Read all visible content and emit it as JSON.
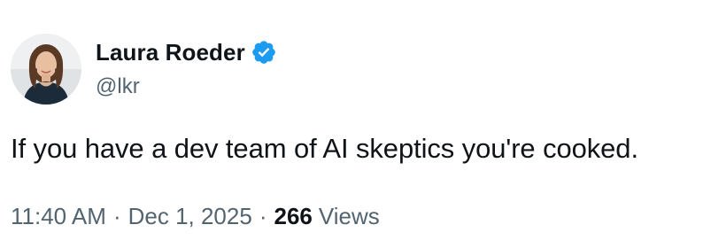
{
  "author": {
    "display_name": "Laura Roeder",
    "handle": "@lkr",
    "verified": true,
    "avatar_icon": "avatar-photo-icon",
    "verified_icon": "verified-badge-icon",
    "verified_color": "#1d9bf0"
  },
  "tweet": {
    "text": "If you have a dev team of AI skeptics you're cooked."
  },
  "meta": {
    "time": "11:40 AM",
    "separator": "·",
    "date": "Dec 1, 2025",
    "views_count": "266",
    "views_label": "Views"
  },
  "colors": {
    "text_primary": "#0f1419",
    "text_secondary": "#536471",
    "background": "#ffffff"
  }
}
